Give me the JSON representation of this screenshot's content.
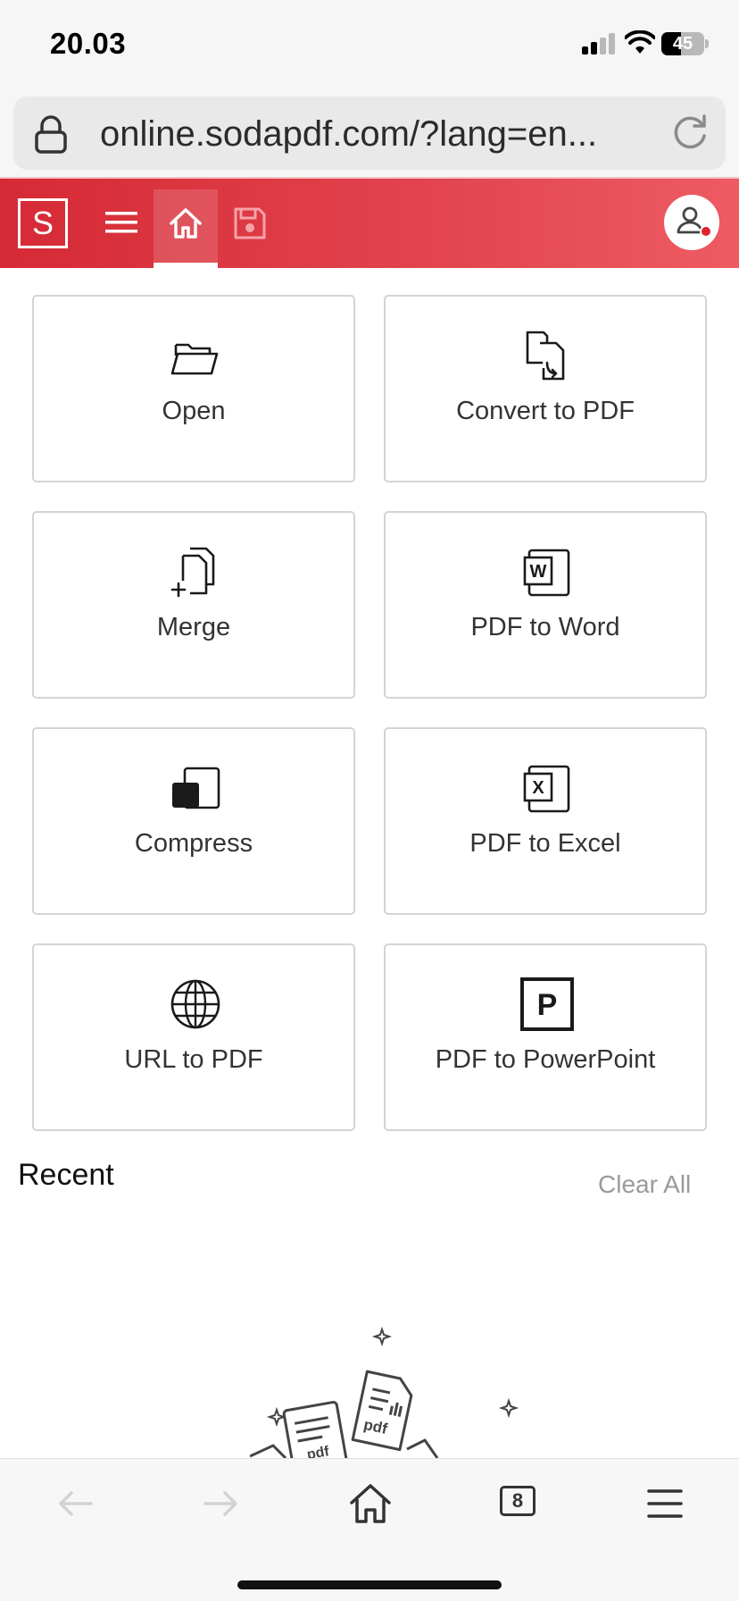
{
  "status_bar": {
    "time": "20.03",
    "battery_percent": "45"
  },
  "browser": {
    "url": "online.sodapdf.com/?lang=en...",
    "tab_count": "8"
  },
  "app_header": {
    "logo_letter": "S",
    "brand_color": "#e03a44",
    "icons": [
      "menu-icon",
      "home-icon",
      "save-icon",
      "user-icon"
    ]
  },
  "tools": [
    {
      "label": "Open",
      "icon": "folder-icon"
    },
    {
      "label": "Convert to PDF",
      "icon": "convert-icon"
    },
    {
      "label": "Merge",
      "icon": "merge-icon"
    },
    {
      "label": "PDF to Word",
      "icon": "word-icon"
    },
    {
      "label": "Compress",
      "icon": "compress-icon"
    },
    {
      "label": "PDF to Excel",
      "icon": "excel-icon"
    },
    {
      "label": "URL to PDF",
      "icon": "globe-icon"
    },
    {
      "label": "PDF to PowerPoint",
      "icon": "powerpoint-icon"
    }
  ],
  "recent": {
    "title": "Recent",
    "clear_all_label": "Clear All",
    "illustration_labels": [
      "pdf",
      "pdf"
    ]
  },
  "bottom_bar": {
    "icons": [
      "back-icon",
      "forward-icon",
      "home-icon",
      "tabs-icon",
      "menu-icon"
    ]
  }
}
